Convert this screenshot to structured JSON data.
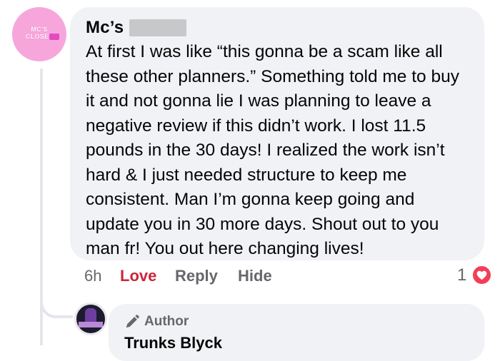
{
  "comment": {
    "avatar_text": "MC'S CLOSET",
    "author": "Mc’s",
    "text": "At first I was like “this gonna be a scam like all these other planners.” Something told me to buy it and not gonna lie I was planning to leave a negative review if this didn’t work. I lost 11.5 pounds in the 30 days! I realized the work isn’t hard & I just needed structure to keep me consistent. Man I’m gonna keep going and update you in 30 more days. Shout out to you man fr! You out here changing lives!",
    "time": "6h",
    "love_label": "Love",
    "reply_label": "Reply",
    "hide_label": "Hide",
    "reaction_count": "1",
    "reaction_icon": "heart-icon",
    "love_color": "#c9263b"
  },
  "reply": {
    "badge": "Author",
    "badge_icon": "pencil-icon",
    "author": "Trunks Blyck"
  }
}
